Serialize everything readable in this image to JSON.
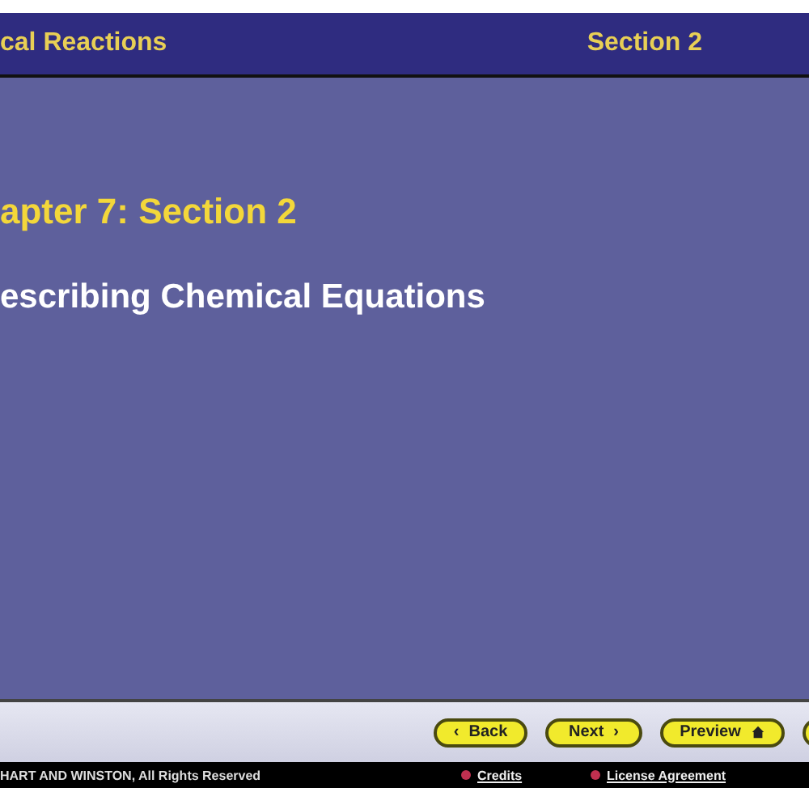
{
  "header": {
    "chapter": "cal Reactions",
    "section": "Section 2"
  },
  "slide": {
    "title": "apter 7: Section 2",
    "subtitle": "escribing Chemical Equations"
  },
  "nav_buttons": [
    {
      "kind": "back",
      "label": "Back",
      "arrow": "‹"
    },
    {
      "kind": "next",
      "label": "Next",
      "arrow": "›"
    },
    {
      "kind": "preview",
      "label": "Preview"
    },
    {
      "kind": "cut"
    }
  ],
  "footer": {
    "copyright": "HART AND WINSTON, All Rights Reserved",
    "links": [
      "Credits",
      "License Agreement"
    ]
  }
}
